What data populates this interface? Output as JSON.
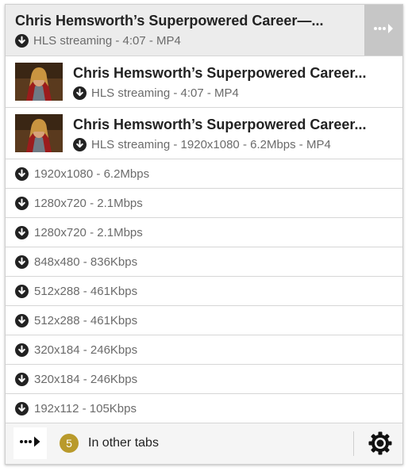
{
  "header": {
    "title": "Chris Hemsworth’s Superpowered Career—...",
    "subtitle": "HLS streaming - 4:07 - MP4"
  },
  "rich_items": [
    {
      "title": "Chris Hemsworth’s Superpowered Career...",
      "subtitle": "HLS streaming - 4:07 - MP4"
    },
    {
      "title": "Chris Hemsworth’s Superpowered Career...",
      "subtitle": "HLS streaming - 1920x1080 - 6.2Mbps - MP4"
    }
  ],
  "variants": [
    "1920x1080 - 6.2Mbps",
    "1280x720 - 2.1Mbps",
    "1280x720 - 2.1Mbps",
    "848x480 - 836Kbps",
    "512x288 - 461Kbps",
    "512x288 - 461Kbps",
    "320x184 - 246Kbps",
    "320x184 - 246Kbps",
    "192x112 - 105Kbps"
  ],
  "footer": {
    "count": "5",
    "other_tabs_label": "In other tabs"
  },
  "colors": {
    "badge": "#b99a2b",
    "header_bg": "#ececec",
    "more_button_bg": "#c6c6c6"
  },
  "icons": {
    "download": "download-circle-icon",
    "more": "more-arrow-icon",
    "settings": "gear-icon"
  }
}
